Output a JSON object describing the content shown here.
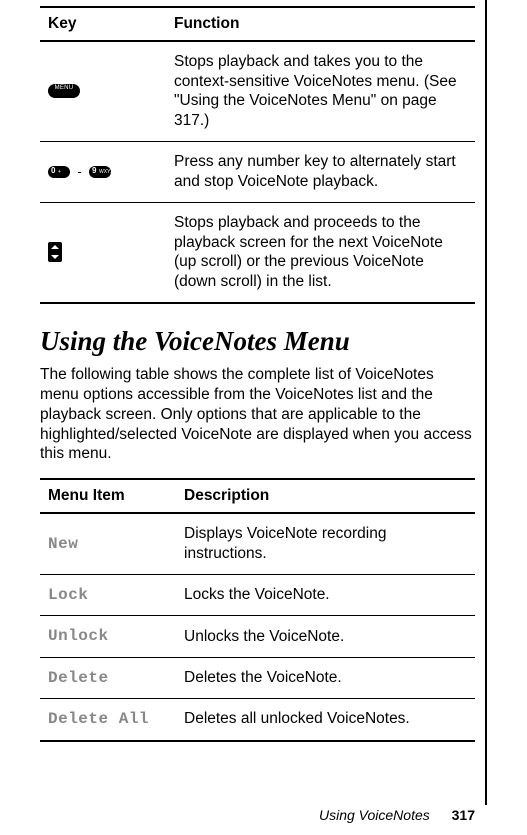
{
  "keytable": {
    "headers": [
      "Key",
      "Function"
    ],
    "rows": [
      {
        "key_icon": "menu-key",
        "function": "Stops playback and takes you to the context-sensitive VoiceNotes menu. (See \"Using the VoiceNotes Menu\" on page 317.)"
      },
      {
        "key_icon": "num-range",
        "function": "Press any number key to alternately start and stop VoiceNote playback."
      },
      {
        "key_icon": "scroll-key",
        "function": "Stops playback and proceeds to the playback screen for the next VoiceNote (up scroll) or the previous VoiceNote (down scroll) in the list."
      }
    ]
  },
  "section_heading": "Using the VoiceNotes Menu",
  "section_body": "The following table shows the complete list of VoiceNotes menu options accessible from the VoiceNotes list and the playback screen. Only options that are applicable to the highlighted/selected VoiceNote are displayed when you access this menu.",
  "menutable": {
    "headers": [
      "Menu Item",
      "Description"
    ],
    "rows": [
      {
        "item": "New",
        "desc": "Displays VoiceNote recording instructions."
      },
      {
        "item": "Lock",
        "desc": "Locks the VoiceNote."
      },
      {
        "item": "Unlock",
        "desc": "Unlocks the VoiceNote."
      },
      {
        "item": "Delete",
        "desc": "Deletes the VoiceNote."
      },
      {
        "item": "Delete All",
        "desc": "Deletes all unlocked VoiceNotes."
      }
    ]
  },
  "footer": {
    "title": "Using VoiceNotes",
    "page": "317"
  },
  "numkeys": {
    "start_digit": "0",
    "start_sub": "+",
    "end_digit": "9",
    "end_sub": "WXYZ"
  }
}
